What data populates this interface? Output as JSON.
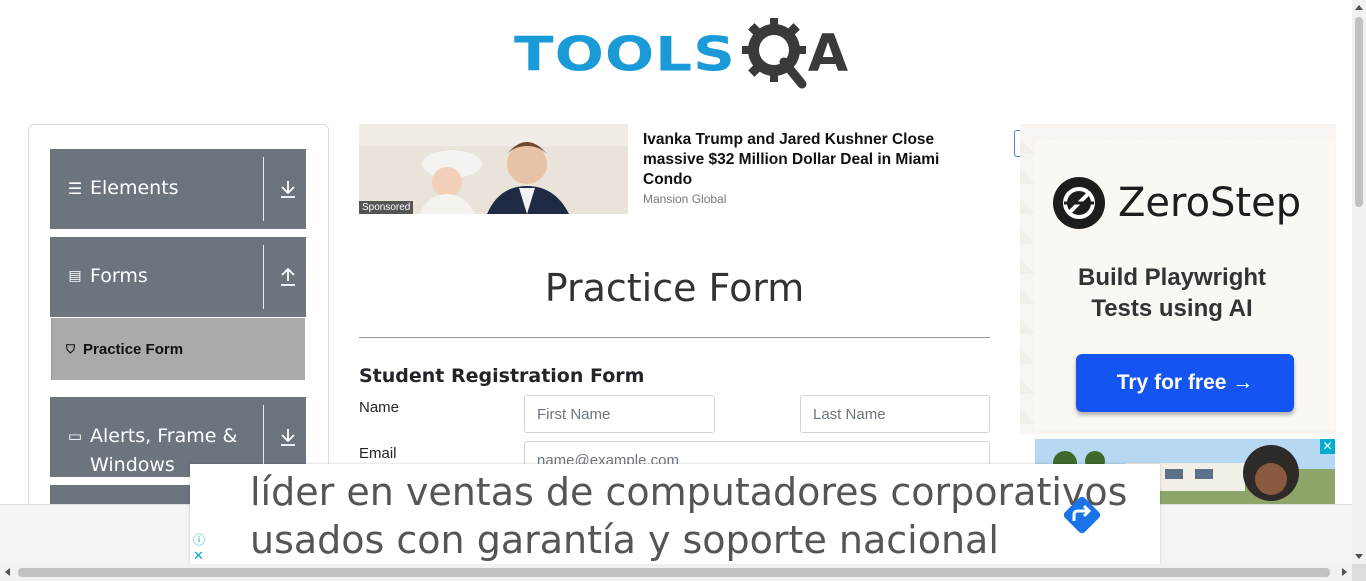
{
  "header": {
    "logo_text_left": "TOOLS",
    "logo_text_right": "A",
    "colors": {
      "tools_blue": "#1a9ad6",
      "qa_dark": "#3a3a3a"
    }
  },
  "sidebar": {
    "groups": [
      {
        "label": "Elements",
        "icon": "hamburger-icon",
        "state": "collapsed",
        "arrow": "download-arrow-icon"
      },
      {
        "label": "Forms",
        "icon": "document-icon",
        "state": "expanded",
        "arrow": "upload-arrow-icon",
        "items": [
          {
            "label": "Practice Form",
            "icon": "html5-icon",
            "active": true
          }
        ]
      },
      {
        "label_line1": "Alerts, Frame &",
        "label_line2": "Windows",
        "icon": "window-icon",
        "state": "collapsed",
        "arrow": "download-arrow-icon"
      }
    ],
    "colors": {
      "group_bg": "#6c757d",
      "active_item_bg": "#aaaaaa"
    }
  },
  "sponsored": {
    "tag": "Sponsored",
    "headline": "Ivanka Trump and Jared Kushner Close massive $32 Million Dollar Deal in Miami Condo",
    "source": "Mansion Global"
  },
  "main": {
    "title": "Practice Form",
    "form_heading": "Student Registration Form",
    "name_label": "Name",
    "first_name_placeholder": "First Name",
    "last_name_placeholder": "Last Name",
    "email_label": "Email",
    "email_placeholder": "name@example.com"
  },
  "right_ad": {
    "brand": "ZeroStep",
    "tagline": "Build Playwright Tests using AI",
    "button": "Try for free →",
    "colors": {
      "button_bg": "#1454f0"
    }
  },
  "bottom_ad": {
    "line1": "líder en ventas de computadores corporativos",
    "line2": "usados con garantía y soporte nacional",
    "info_icon": "ⓘ",
    "close_icon": "✕"
  }
}
